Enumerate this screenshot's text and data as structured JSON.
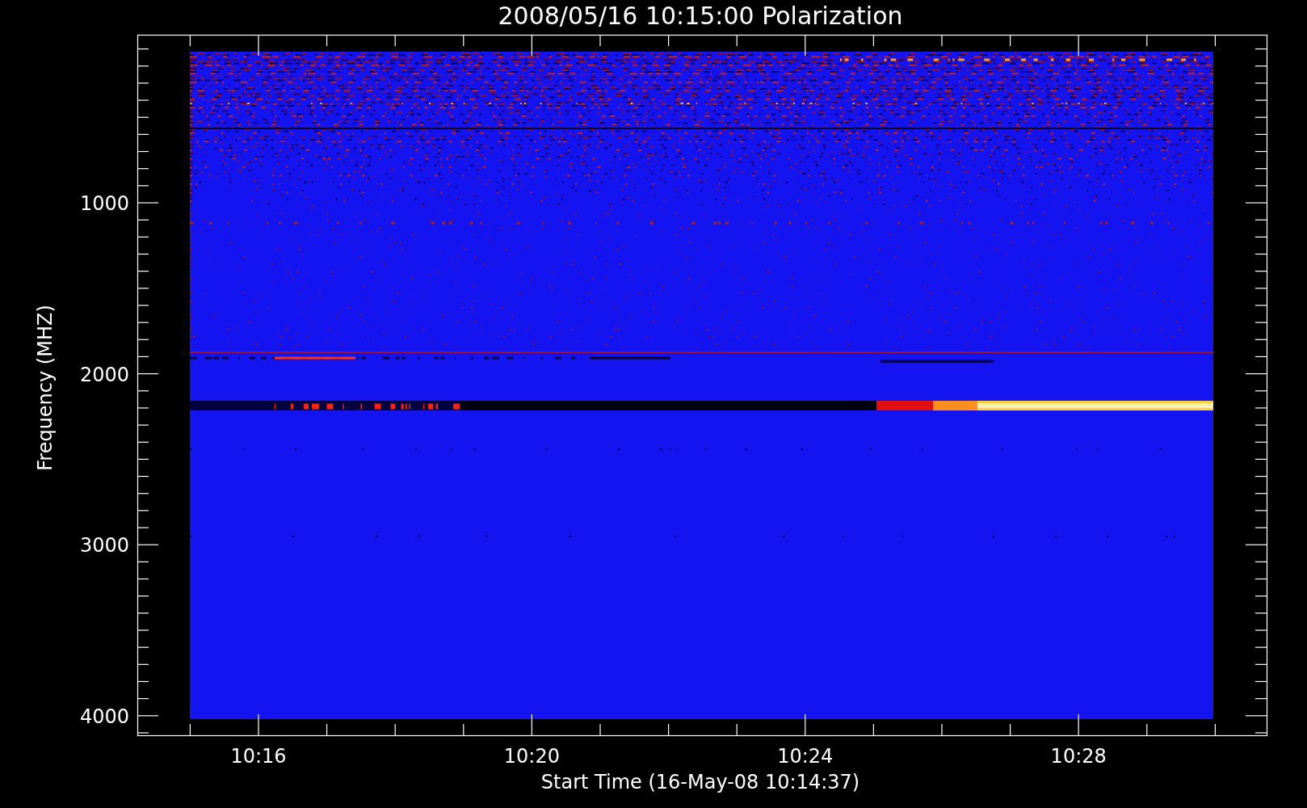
{
  "title": "2008/05/16 10:15:00 Polarization",
  "y_axis": {
    "label": "Frequency (MHZ)",
    "ticks": [
      "1000",
      "2000",
      "3000",
      "4000"
    ]
  },
  "x_axis": {
    "label": "Start Time (16-May-08 10:14:37)",
    "ticks": [
      "10:16",
      "10:20",
      "10:24",
      "10:28"
    ]
  }
}
